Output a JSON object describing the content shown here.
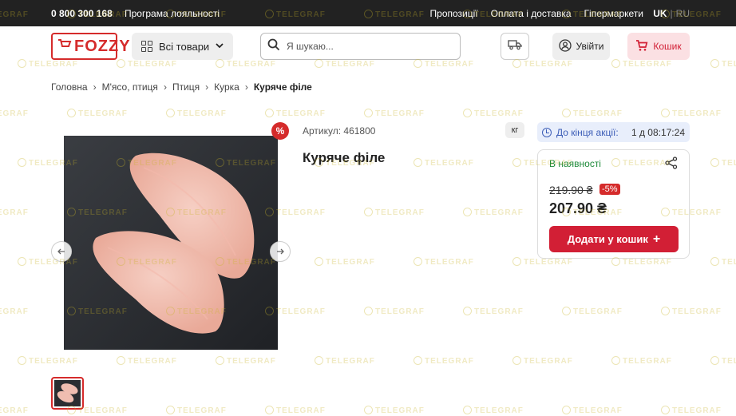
{
  "topbar": {
    "phone": "0 800 300 168",
    "loyalty": "Програма лояльності",
    "links": [
      "Пропозиції",
      "Оплата і доставка",
      "Гіпермаркети"
    ],
    "lang_active": "UK",
    "lang_sep": "|",
    "lang_other": "RU"
  },
  "header": {
    "logo_text": "FOZZY",
    "all_goods": "Всі товари",
    "search_placeholder": "Я шукаю...",
    "login": "Увійти",
    "cart": "Кошик"
  },
  "breadcrumbs": [
    "Головна",
    "М'ясо, птиця",
    "Птиця",
    "Курка",
    "Куряче філе"
  ],
  "product": {
    "sku": "Артикул: 461800",
    "unit": "кг",
    "title": "Куряче філе",
    "promo_badge": "%",
    "timer_label": "До кінця акції:",
    "timer_value": "1 д 08:17:24",
    "availability": "В наявності",
    "old_price": "219.90 ₴",
    "discount": "-5%",
    "price": "207.90 ₴",
    "add_to_cart": "Додати у кошик",
    "add_plus": "+"
  },
  "watermark": "TELEGRAF",
  "colors": {
    "brand_red": "#d21f35",
    "topbar_bg": "#222222",
    "stock_green": "#1e8a3a",
    "timer_blue": "#3c5db7"
  }
}
